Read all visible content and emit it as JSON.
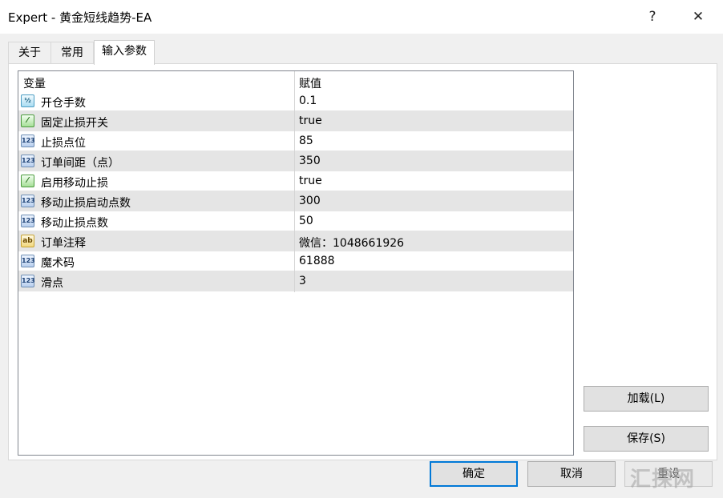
{
  "window": {
    "title": "Expert - 黄金短线趋势-EA",
    "help_glyph": "?",
    "close_glyph": "✕"
  },
  "tabs": [
    {
      "label": "关于",
      "active": false
    },
    {
      "label": "常用",
      "active": false
    },
    {
      "label": "输入参数",
      "active": true
    }
  ],
  "grid": {
    "headers": {
      "variable": "变量",
      "value": "赋值"
    },
    "rows": [
      {
        "icon": "fraction-icon",
        "icon_text": "½",
        "name": "开仓手数",
        "value": "0.1"
      },
      {
        "icon": "boolean-icon",
        "icon_text": "⁄",
        "name": "固定止损开关",
        "value": "true"
      },
      {
        "icon": "integer-icon",
        "icon_text": "123",
        "name": "止损点位",
        "value": "85"
      },
      {
        "icon": "integer-icon",
        "icon_text": "123",
        "name": "订单间距（点）",
        "value": "350"
      },
      {
        "icon": "boolean-icon",
        "icon_text": "⁄",
        "name": "启用移动止损",
        "value": "true"
      },
      {
        "icon": "integer-icon",
        "icon_text": "123",
        "name": "移动止损启动点数",
        "value": "300"
      },
      {
        "icon": "integer-icon",
        "icon_text": "123",
        "name": "移动止损点数",
        "value": "50"
      },
      {
        "icon": "string-icon",
        "icon_text": "ab",
        "name": "订单注释",
        "value": "微信：1048661926"
      },
      {
        "icon": "integer-icon",
        "icon_text": "123",
        "name": "魔术码",
        "value": "61888"
      },
      {
        "icon": "integer-icon",
        "icon_text": "123",
        "name": "滑点",
        "value": "3"
      }
    ]
  },
  "buttons": {
    "load": "加载(L)",
    "save": "保存(S)",
    "ok": "确定",
    "cancel": "取消",
    "reset": "重设"
  },
  "watermark": "汇探网"
}
